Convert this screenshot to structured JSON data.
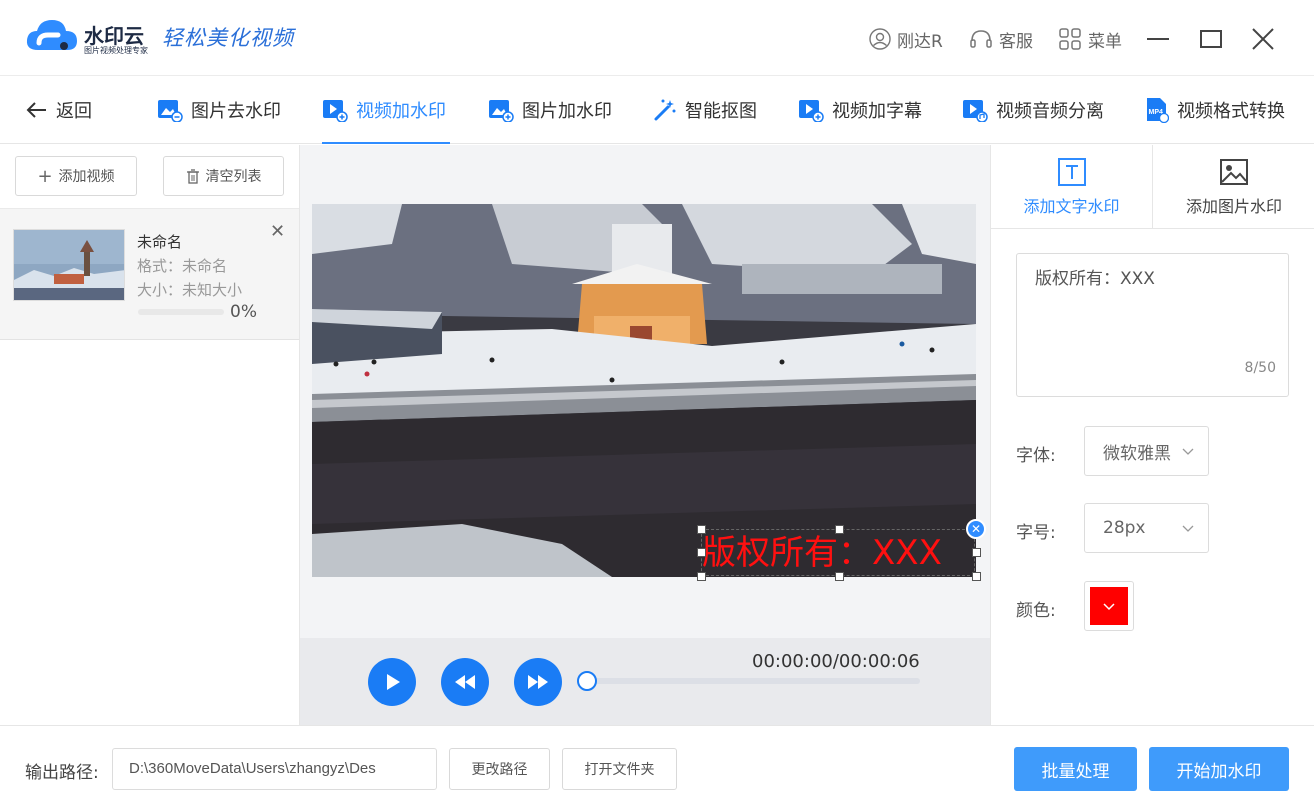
{
  "app": {
    "brand": "水印云",
    "brand_sub": "图片视频处理专家",
    "slogan": "轻松美化视频"
  },
  "titlebar": {
    "user": "刚达R",
    "support": "客服",
    "menu": "菜单"
  },
  "nav": {
    "back": "返回",
    "items": [
      {
        "label": "图片去水印",
        "active": false
      },
      {
        "label": "视频加水印",
        "active": true
      },
      {
        "label": "图片加水印",
        "active": false
      },
      {
        "label": "智能抠图",
        "active": false
      },
      {
        "label": "视频加字幕",
        "active": false
      },
      {
        "label": "视频音频分离",
        "active": false
      },
      {
        "label": "视频格式转换",
        "active": false
      }
    ]
  },
  "left": {
    "add_video": "添加视频",
    "clear_list": "清空列表",
    "file": {
      "name": "未命名",
      "format": "格式：未命名",
      "size": "大小：未知大小",
      "progress": "0%"
    }
  },
  "preview": {
    "watermark_text": "版权所有：XXX",
    "timecode": "00:00:00/00:00:06",
    "playback_progress": 0
  },
  "right": {
    "tab_text": "添加文字水印",
    "tab_image": "添加图片水印",
    "watermark_input": "版权所有：XXX",
    "char_count": "8/50",
    "font_label": "字体:",
    "font_value": "微软雅黑",
    "size_label": "字号:",
    "size_value": "28px",
    "color_label": "颜色:",
    "color_value": "#ff0000"
  },
  "bottom": {
    "output_label": "输出路径:",
    "output_path": "D:\\360MoveData\\Users\\zhangyz\\Des",
    "change_path": "更改路径",
    "open_folder": "打开文件夹",
    "batch": "批量处理",
    "start": "开始加水印"
  },
  "colors": {
    "accent": "#2f8cff",
    "primary_button": "#3f9bfb",
    "player_button": "#1a7cf5",
    "watermark": "#ff1010"
  }
}
